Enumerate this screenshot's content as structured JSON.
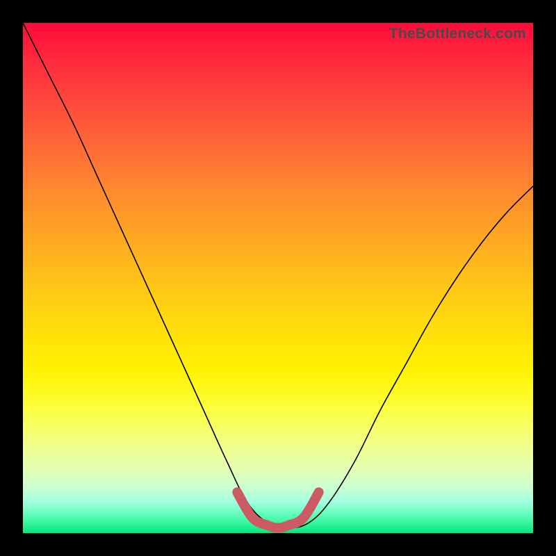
{
  "watermark": "TheBottleneck.com",
  "chart_data": {
    "type": "line",
    "title": "",
    "xlabel": "",
    "ylabel": "",
    "xlim": [
      0,
      100
    ],
    "ylim": [
      0,
      100
    ],
    "grid": false,
    "series": [
      {
        "name": "curve",
        "x": [
          0,
          5,
          10,
          15,
          20,
          25,
          30,
          35,
          40,
          44,
          48,
          52,
          56,
          60,
          65,
          70,
          75,
          80,
          85,
          90,
          95,
          100
        ],
        "y": [
          100,
          90,
          80,
          69,
          58,
          47,
          36,
          25,
          14,
          6,
          2,
          1,
          2,
          6,
          14,
          24,
          33,
          42,
          50,
          57,
          63,
          68
        ]
      },
      {
        "name": "highlight-valley",
        "x": [
          42,
          45,
          48,
          50,
          52,
          55,
          58
        ],
        "y": [
          8,
          3,
          1.5,
          1,
          1.5,
          3,
          8
        ]
      }
    ]
  }
}
